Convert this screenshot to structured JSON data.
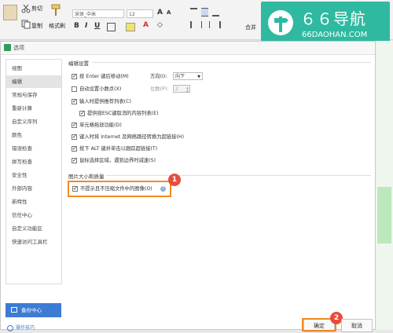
{
  "toolbar": {
    "cut_label": "剪切",
    "copy_label": "复制",
    "format_painter_label": "格式刷",
    "font_name": "宋体_中米",
    "font_size": "12",
    "font_grow": "A",
    "font_shrink": "A",
    "merge_label": "合并"
  },
  "watermark": {
    "title": "６６导航",
    "url": "66DAOHAN.COM"
  },
  "dialog": {
    "title": "选项",
    "sidebar": {
      "items": [
        {
          "label": "视图"
        },
        {
          "label": "编辑"
        },
        {
          "label": "常规与保存"
        },
        {
          "label": "重新计算"
        },
        {
          "label": "自定义序列"
        },
        {
          "label": "颜色"
        },
        {
          "label": "错误检查"
        },
        {
          "label": "拼写检查"
        },
        {
          "label": "安全性"
        },
        {
          "label": "外部内容"
        },
        {
          "label": "新特性"
        },
        {
          "label": "信任中心"
        },
        {
          "label": "自定义功能区"
        },
        {
          "label": "快速访问工具栏"
        }
      ],
      "active_index": 1,
      "backup_button": "备份中心",
      "tips_link": "操作技巧"
    },
    "edit_settings": {
      "group_title": "编辑设置",
      "options": [
        {
          "label": "按 Enter 键后移动(M)",
          "checked": true
        },
        {
          "label": "自动设置小数点(X)",
          "checked": false
        },
        {
          "label": "输入时提供推荐列表(C)",
          "checked": true
        },
        {
          "label": "提供按ESC键取消的内容列表(E)",
          "checked": true
        },
        {
          "label": "单元格拖放功能(D)",
          "checked": true
        },
        {
          "label": "键入时将 Internet 及网络路径转换为超链接(H)",
          "checked": true
        },
        {
          "label": "按下 ALT 键并单击以跟踪超链接(T)",
          "checked": true
        },
        {
          "label": "鼠标选择区域，遇到边界时减速(S)",
          "checked": true
        }
      ],
      "direction_label": "方向(I):",
      "direction_value": "向下",
      "digits_label": "位数(P):",
      "digits_value": "2"
    },
    "image_settings": {
      "group_title": "图片大小和质量",
      "option_label": "不提示且不压缩文件中的图像(O)",
      "option_checked": true,
      "help_glyph": "?"
    },
    "ok_button": "确定",
    "cancel_button": "取消"
  },
  "badges": [
    "1",
    "2"
  ],
  "colors": {
    "accent_blue": "#3d7bd4",
    "highlight_orange": "#f08a24",
    "badge_red": "#e84d3c",
    "watermark_teal": "#2fb9a0"
  }
}
